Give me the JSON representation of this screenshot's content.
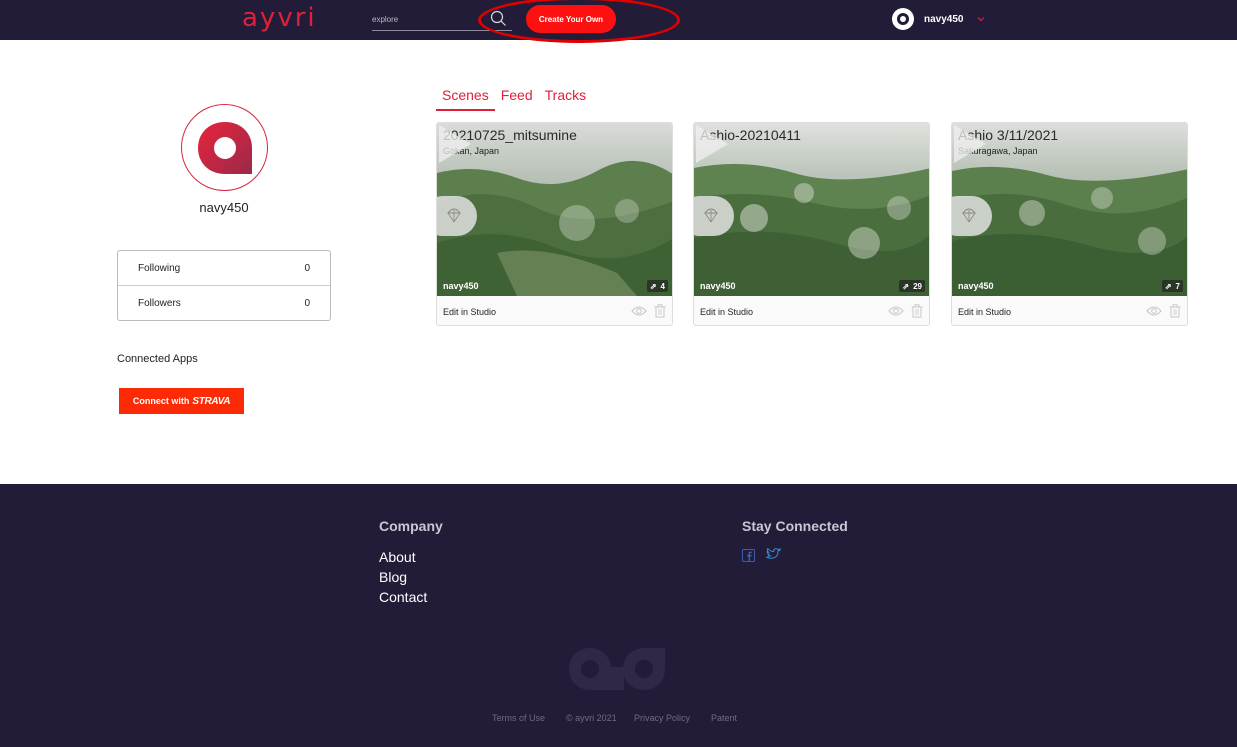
{
  "header": {
    "logo": "ayvri",
    "search": {
      "placeholder": "explore",
      "value": ""
    },
    "create_button": "Create Your Own",
    "username": "navy450"
  },
  "profile": {
    "username": "navy450",
    "stats": [
      {
        "label": "Following",
        "value": "0"
      },
      {
        "label": "Followers",
        "value": "0"
      }
    ],
    "connected_apps_label": "Connected Apps",
    "strava": {
      "prefix": "Connect with",
      "brand": "STRAVA"
    }
  },
  "tabs": [
    {
      "label": "Scenes",
      "active": true
    },
    {
      "label": "Feed",
      "active": false
    },
    {
      "label": "Tracks",
      "active": false
    }
  ],
  "scenes": [
    {
      "title": "20210725_mitsumine",
      "location": "Gokan, Japan",
      "user": "navy450",
      "tracks": "4",
      "action": "Edit in Studio"
    },
    {
      "title": "Ashio-20210411",
      "location": "",
      "user": "navy450",
      "tracks": "29",
      "action": "Edit in Studio"
    },
    {
      "title": "Ashio 3/11/2021",
      "location": "Sakuragawa, Japan",
      "user": "navy450",
      "tracks": "7",
      "action": "Edit in Studio"
    }
  ],
  "footer": {
    "company_heading": "Company",
    "company_links": [
      "About",
      "Blog",
      "Contact"
    ],
    "stay_connected_heading": "Stay Connected",
    "social_icons": [
      "facebook-icon",
      "twitter-icon"
    ],
    "legal": [
      "Terms of Use",
      "© ayvri 2021",
      "Privacy Policy",
      "Patent"
    ]
  },
  "colors": {
    "brand_red": "#e0203a",
    "navy": "#221c38",
    "button_red": "#ff1010",
    "strava_orange": "#fc2b05"
  }
}
